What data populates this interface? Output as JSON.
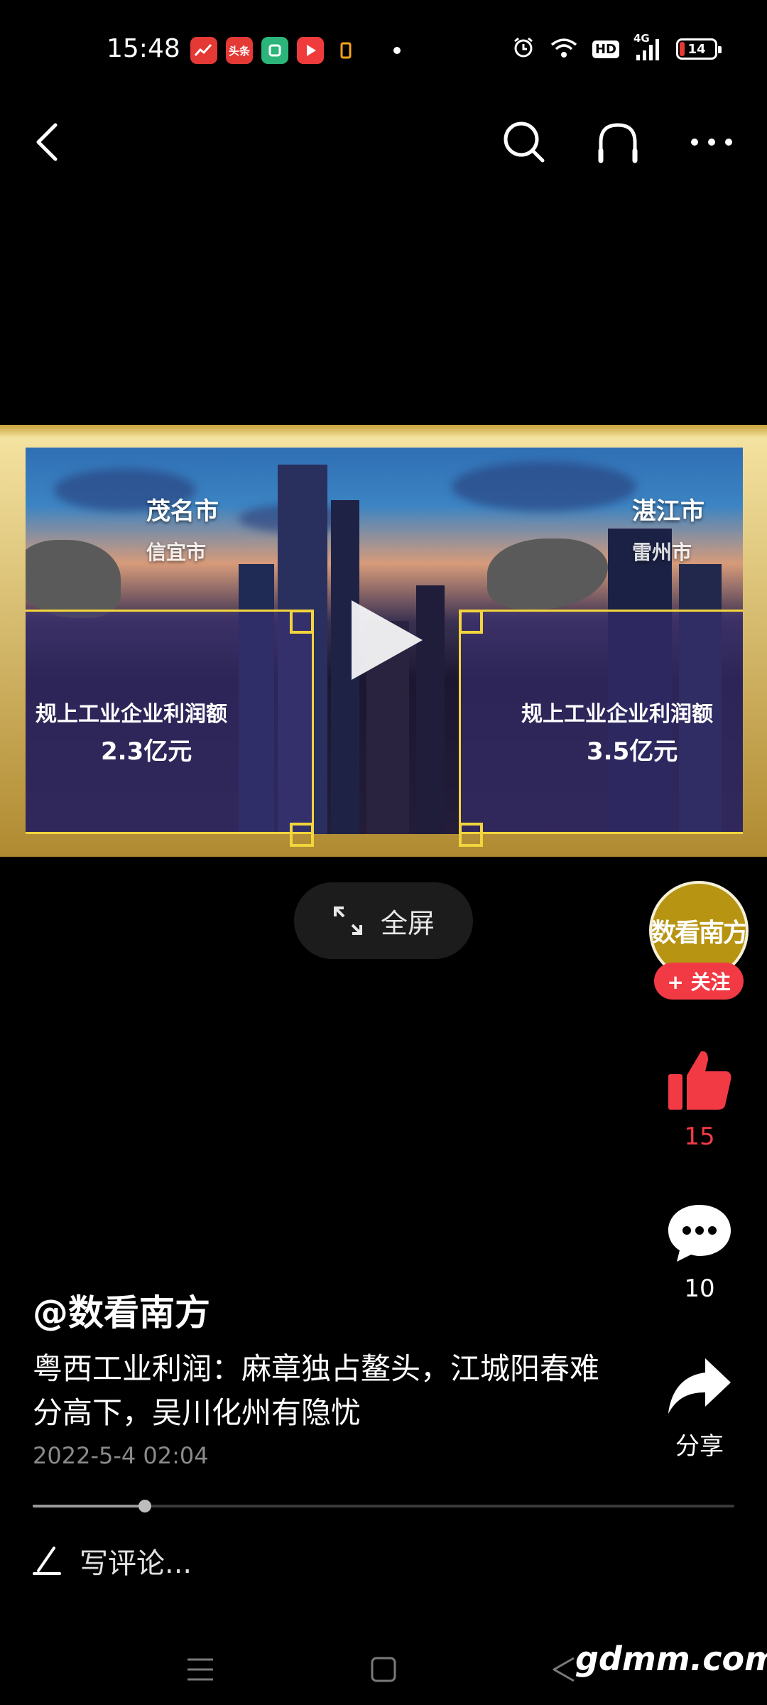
{
  "status_bar": {
    "time": "15:48",
    "app_icons": [
      {
        "name": "stock-app-icon",
        "color": "#e53935",
        "glyph": "📈"
      },
      {
        "name": "toutiao-app-icon",
        "color": "#e53935",
        "glyph": "头条"
      },
      {
        "name": "green-app-icon",
        "color": "#2bb57a",
        "glyph": "▢"
      },
      {
        "name": "video-app-icon",
        "color": "#ef3b3b",
        "glyph": "▶"
      },
      {
        "name": "orange-app-icon",
        "color": "#000000",
        "glyph": "▯"
      }
    ],
    "network_label": "4G",
    "hd_label": "HD",
    "battery_level": "14"
  },
  "video": {
    "left_city": "茂名市",
    "left_subcity": "信宜市",
    "right_city": "湛江市",
    "right_subcity": "雷州市",
    "left_profit_label": "规上工业企业利润额",
    "left_profit_value": "2.3亿元",
    "right_profit_label": "规上工业企业利润额",
    "right_profit_value": "3.5亿元",
    "accent_color": "#f2d43c"
  },
  "fullscreen_label": "全屏",
  "author": {
    "avatar_text": "数看南方",
    "follow_label": "+ 关注",
    "handle": "@数看南方"
  },
  "actions": {
    "like_count": "15",
    "comment_count": "10",
    "share_label": "分享",
    "like_color": "#f23a45"
  },
  "post": {
    "caption": "粤西工业利润：麻章独占鳌头，江城阳春难分高下，吴川化州有隐忧",
    "date": "2022-5-4 02:04"
  },
  "progress": {
    "fraction": 0.16
  },
  "comment": {
    "placeholder": "写评论..."
  },
  "watermark": "gdmm.com"
}
